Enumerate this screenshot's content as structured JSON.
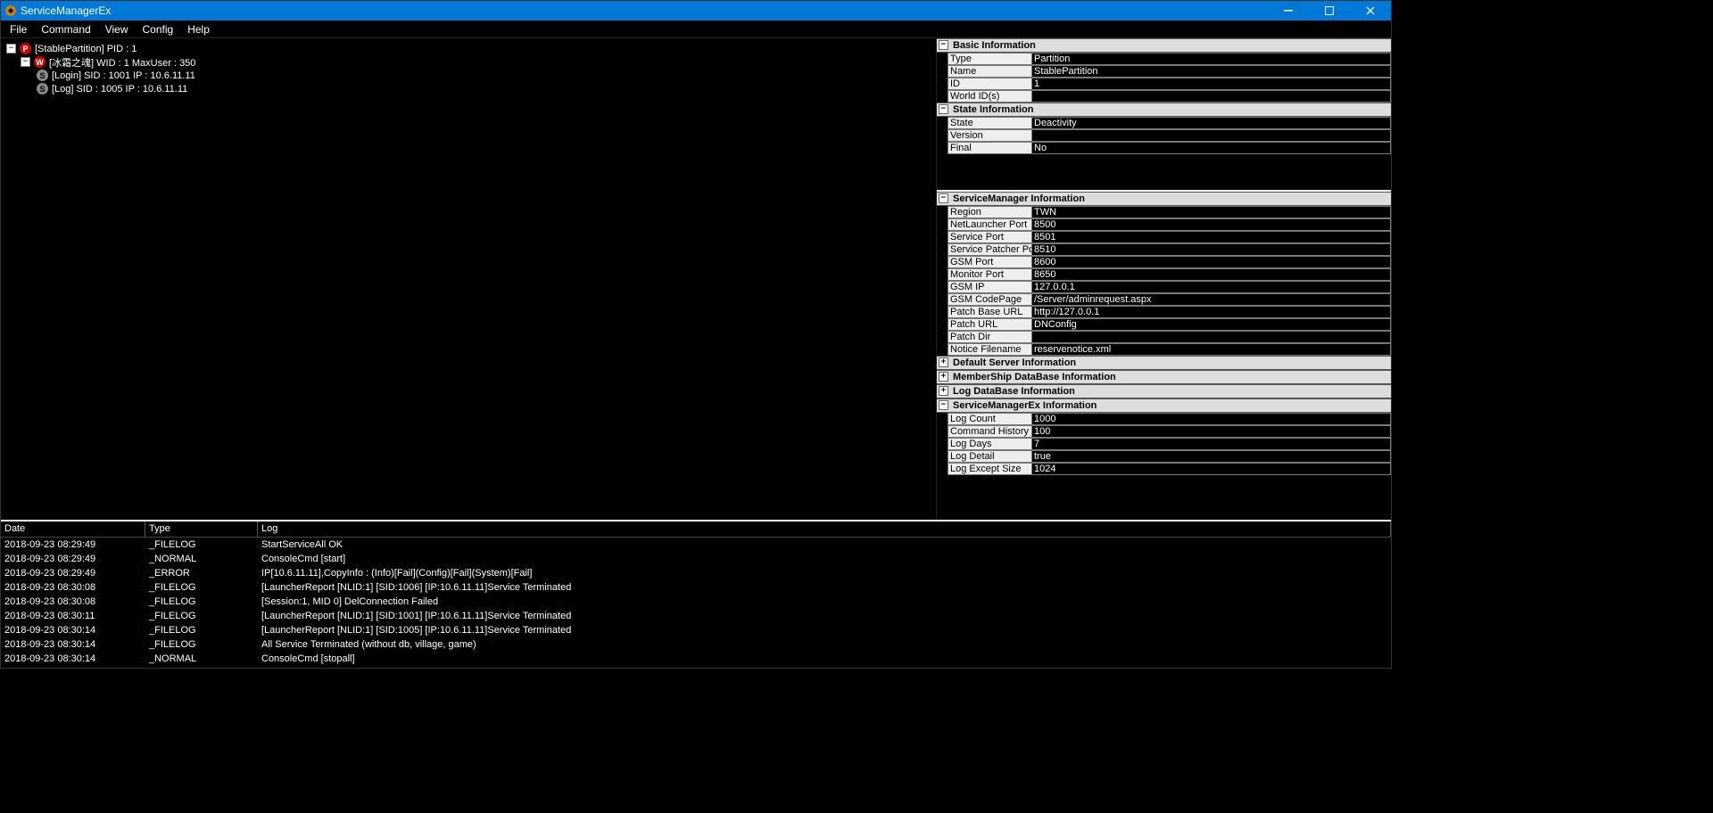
{
  "titlebar": {
    "title": "ServiceManagerEx"
  },
  "menu": {
    "items": [
      "File",
      "Command",
      "View",
      "Config",
      "Help"
    ]
  },
  "tree": {
    "node0": "[StablePartition] PID : 1",
    "node1": "[冰霜之魂] WID : 1 MaxUser : 350",
    "node2": "[Login] SID : 1001 IP : 10.6.11.11",
    "node3": "[Log] SID : 1005 IP : 10.6.11.11"
  },
  "panels": {
    "basic": {
      "title": "Basic Information",
      "rows": {
        "Type": "Partition",
        "Name": "StablePartition",
        "ID": "1",
        "World ID(s)": ""
      }
    },
    "state": {
      "title": "State Information",
      "rows": {
        "State": "Deactivity",
        "Version": "",
        "Final": "No"
      }
    },
    "svc": {
      "title": "ServiceManager Information",
      "rows": {
        "Region": "TWN",
        "NetLauncher Port": "8500",
        "Service Port": "8501",
        "Service Patcher Port": "8510",
        "GSM Port": "8600",
        "Monitor Port": "8650",
        "GSM IP": "127.0.0.1",
        "GSM CodePage": "/Server/adminrequest.aspx",
        "Patch Base URL": "http://127.0.0.1",
        "Patch URL": "DNConfig",
        "Patch Dir": "",
        "Notice Filename": "reservenotice.xml"
      }
    },
    "collapsed": {
      "c1": "Default Server Information",
      "c2": "MemberShip DataBase Information",
      "c3": "Log DataBase Information"
    },
    "smex": {
      "title": "ServiceManagerEx Information",
      "rows": {
        "Log Count": "1000",
        "Command History ...": "100",
        "Log Days": "7",
        "Log Detail": "true",
        "Log Except Size": "1024"
      }
    }
  },
  "log": {
    "headers": {
      "date": "Date",
      "type": "Type",
      "log": "Log"
    },
    "rows": [
      {
        "date": "2018-09-23 08:29:49",
        "type": "_FILELOG",
        "log": "StartServiceAll OK"
      },
      {
        "date": "2018-09-23 08:29:49",
        "type": "_NORMAL",
        "log": "ConsoleCmd [start]"
      },
      {
        "date": "2018-09-23 08:29:49",
        "type": "_ERROR",
        "log": "IP[10.6.11.11],CopyInfo : (Info)[Fail](Config)[Fail](System)[Fail]"
      },
      {
        "date": "2018-09-23 08:30:08",
        "type": "_FILELOG",
        "log": "[LauncherReport [NLID:1] [SID:1006] [IP:10.6.11.11]Service Terminated"
      },
      {
        "date": "2018-09-23 08:30:08",
        "type": "_FILELOG",
        "log": "[Session:1, MID 0] DelConnection Failed"
      },
      {
        "date": "2018-09-23 08:30:11",
        "type": "_FILELOG",
        "log": "[LauncherReport [NLID:1] [SID:1001] [IP:10.6.11.11]Service Terminated"
      },
      {
        "date": "2018-09-23 08:30:14",
        "type": "_FILELOG",
        "log": "[LauncherReport [NLID:1] [SID:1005] [IP:10.6.11.11]Service Terminated"
      },
      {
        "date": "2018-09-23 08:30:14",
        "type": "_FILELOG",
        "log": "All Service Terminated (without db, village, game)"
      },
      {
        "date": "2018-09-23 08:30:14",
        "type": "_NORMAL",
        "log": "ConsoleCmd [stopall]"
      }
    ]
  }
}
